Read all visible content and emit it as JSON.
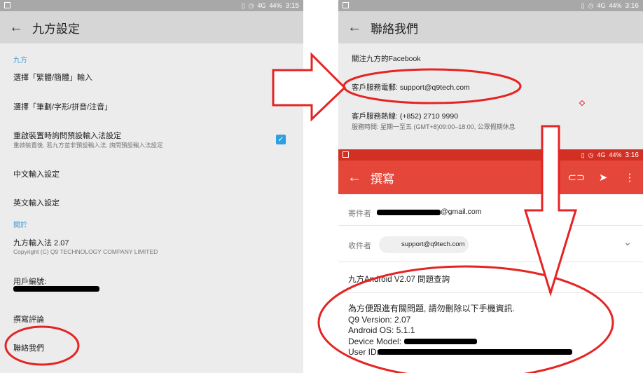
{
  "status": {
    "battery": "44%",
    "signal": "4G",
    "time_left": "3:15",
    "time_right": "3:16"
  },
  "settings": {
    "title": "九方設定",
    "section_main": "九方",
    "item_traditional": "選擇「繁體/簡體」輸入",
    "item_method": "選擇「筆劃/字形/拼音/注音」",
    "item_default": "重啟裝置時詢問預設輸入法設定",
    "item_default_sub": "重啟裝置後, 若九方並非預設輸入法, 詢問預設輸入法設定",
    "item_chinese": "中文輸入設定",
    "item_english": "英文輸入設定",
    "section_about": "關於",
    "version": "九方輸入法 2.07",
    "copyright": "Copyright (C) Q9 TECHNOLOGY COMPANY LIMITED",
    "user_id": "用戶編號:",
    "review": "撰寫評論",
    "contact": "聯絡我們"
  },
  "contact": {
    "title": "聯絡我們",
    "facebook": "關注九方的Facebook",
    "email": "客戶服務電郵: support@q9tech.com",
    "hotline": "客戶服務熱線: (+852) 2710 9990",
    "hours": "服務時間: 星期一至五 (GMT+8)09:00–18:00, 公眾假期休息"
  },
  "compose": {
    "title": "撰寫",
    "from_label": "寄件者",
    "from_value": "@gmail.com",
    "to_label": "收件者",
    "to_value": "support@q9tech.com",
    "subject": "九方Android V2.07 問題查詢",
    "body_line1": "為方便跟進有關問題, 請勿刪除以下手機資訊.",
    "body_line2": "Q9 Version: 2.07",
    "body_line3": "Android OS: 5.1.1",
    "body_line4": "Device Model:",
    "body_line5": "User ID:"
  },
  "colors": {
    "accent_blue": "#3aa0d8",
    "compose_red": "#e4473a",
    "annotation_red": "#e52424"
  }
}
